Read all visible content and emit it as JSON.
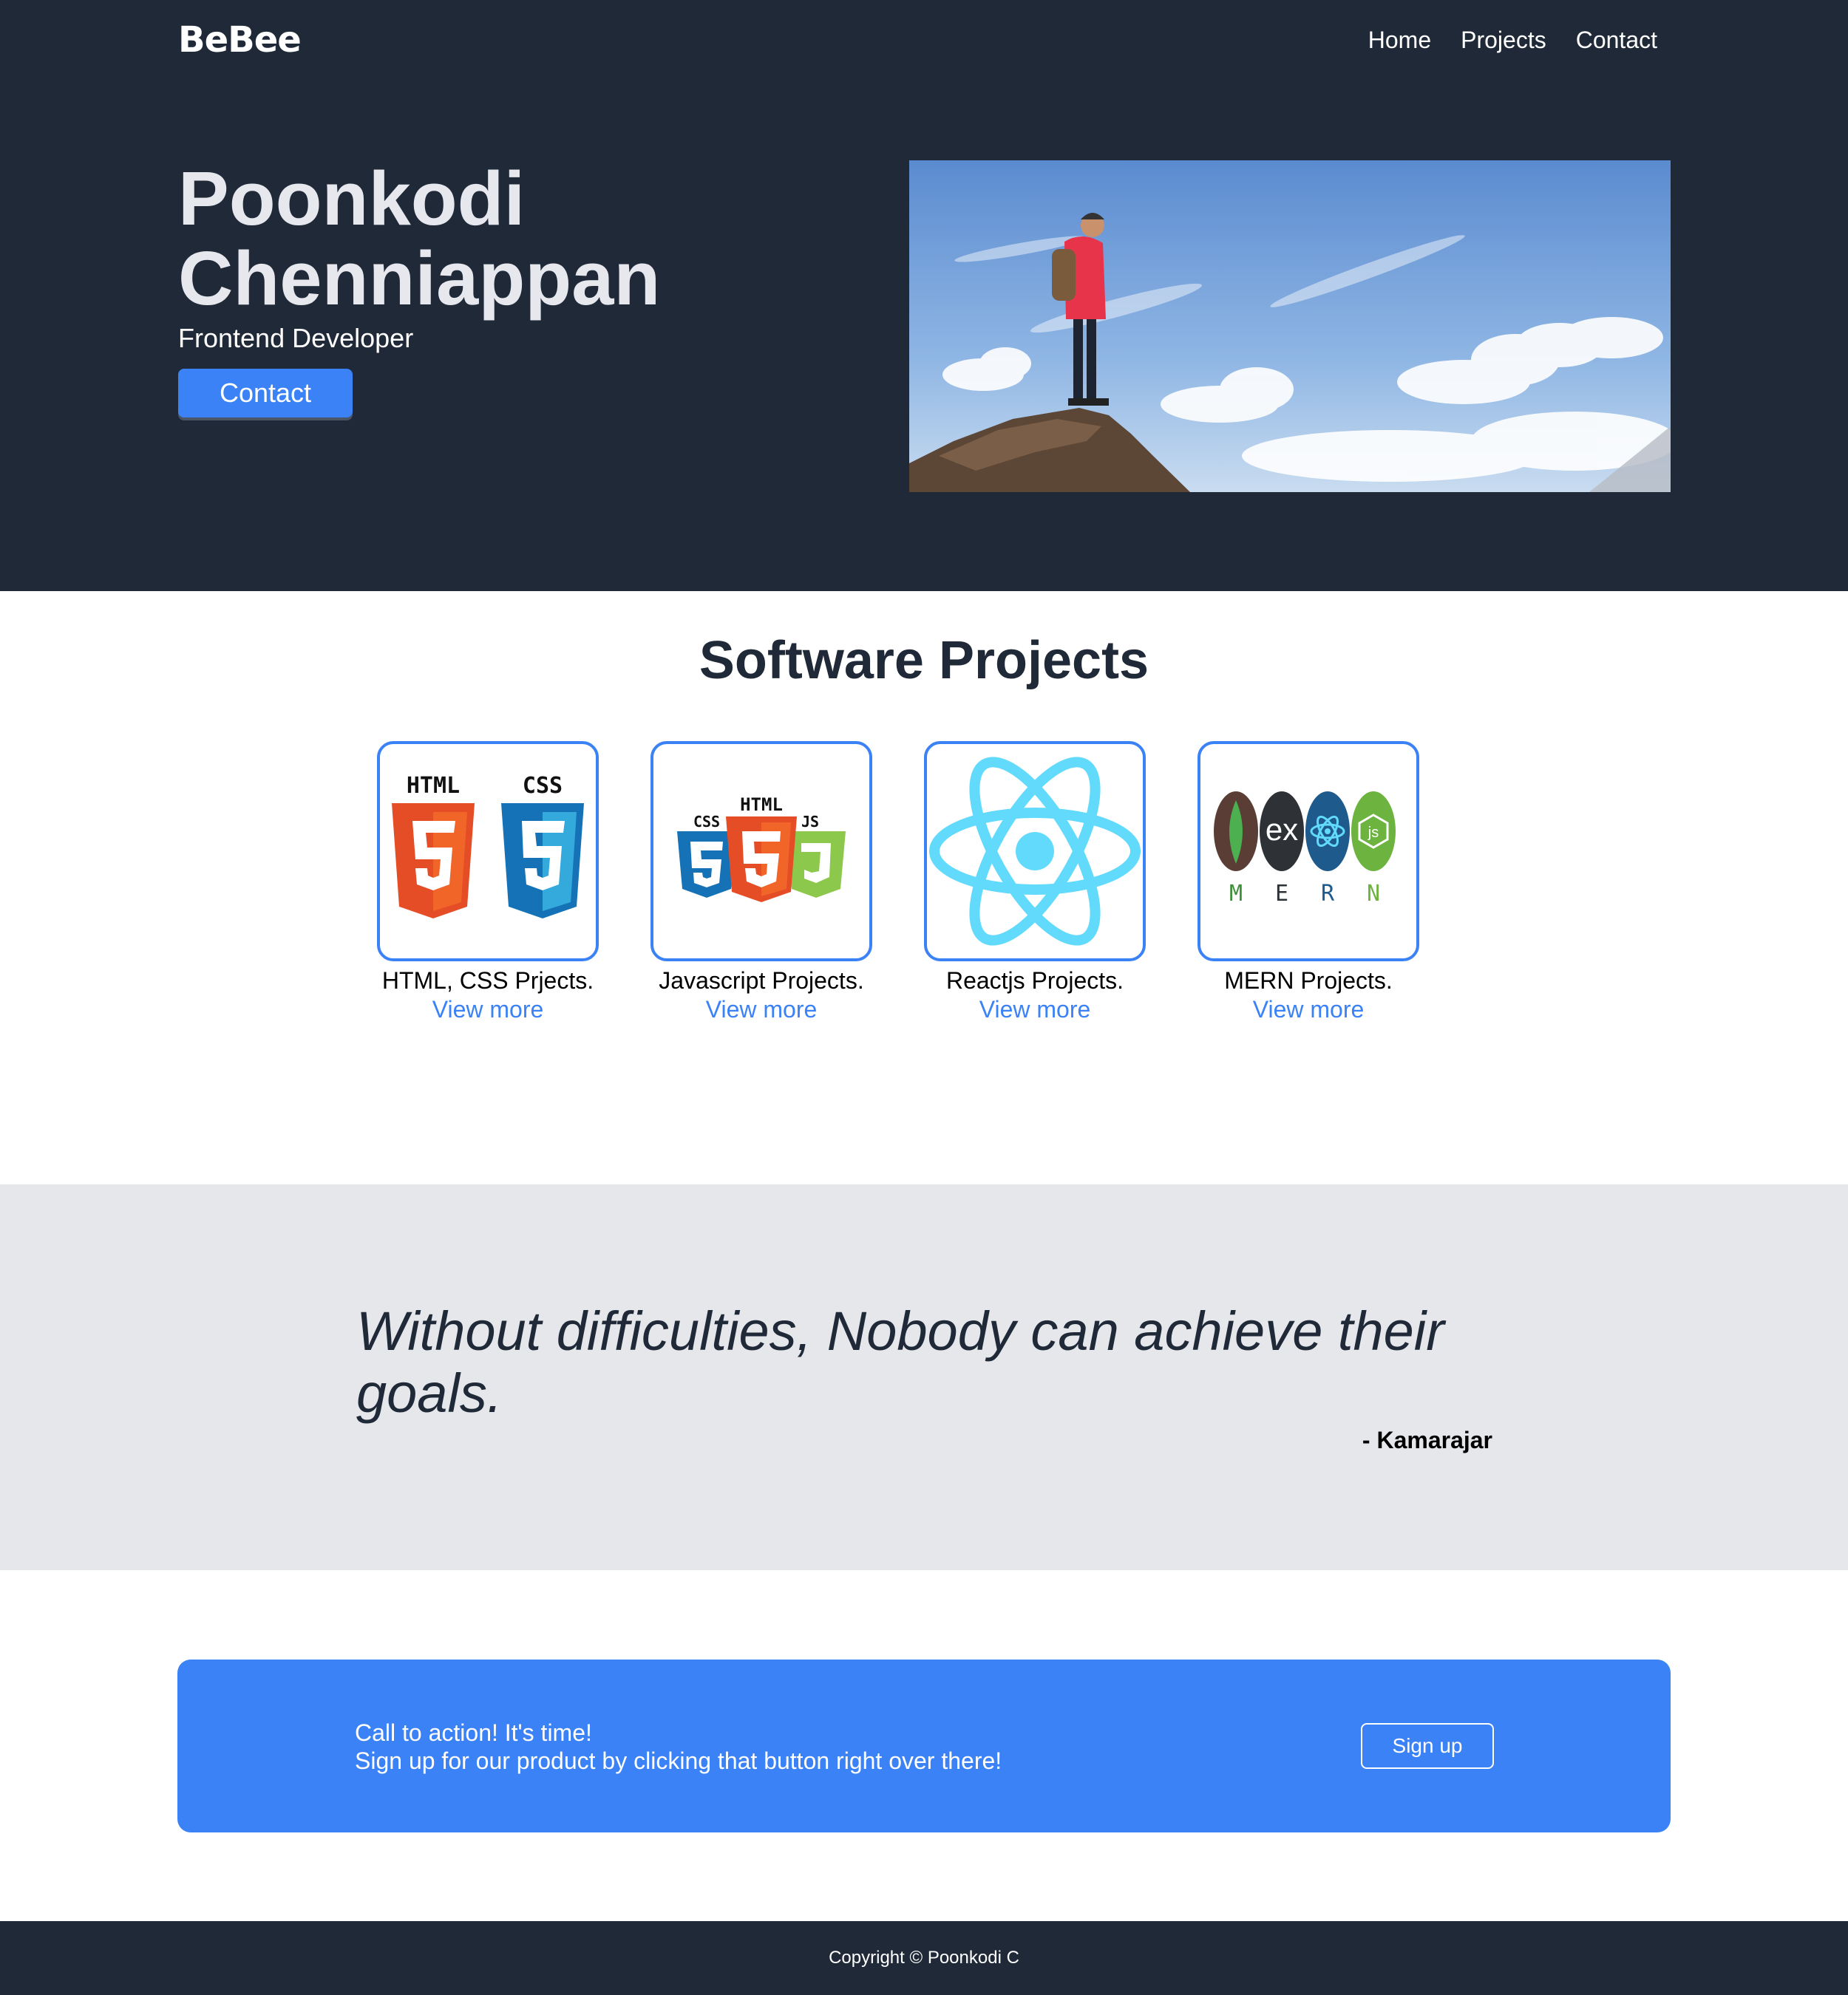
{
  "header": {
    "brand": "BeBee",
    "nav": [
      "Home",
      "Projects",
      "Contact"
    ]
  },
  "hero": {
    "name_line1": "Poonkodi",
    "name_line2": "Chenniappan",
    "role": "Frontend Developer",
    "contact_button": "Contact",
    "image": "hiker-on-cliff-photo"
  },
  "projects": {
    "title": "Software Projects",
    "cards": [
      {
        "title": "HTML, CSS Prjects.",
        "link": "View more",
        "icon": "html-css-logo-icon",
        "logo_labels": [
          "HTML",
          "CSS"
        ]
      },
      {
        "title": "Javascript Projects.",
        "link": "View more",
        "icon": "html-css-js-logo-icon",
        "logo_labels": [
          "CSS",
          "HTML",
          "JS"
        ]
      },
      {
        "title": "Reactjs Projects.",
        "link": "View more",
        "icon": "react-logo-icon"
      },
      {
        "title": "MERN Projects.",
        "link": "View more",
        "icon": "mern-logo-icon",
        "logo_labels": [
          "ex",
          "M",
          "E",
          "R",
          "N"
        ]
      }
    ]
  },
  "quote": {
    "text": "Without difficulties, Nobody can achieve their goals.",
    "author": "- Kamarajar"
  },
  "cta": {
    "line1": "Call to action! It's time!",
    "line2": "Sign up for our product by clicking that button right over there!",
    "button": "Sign up"
  },
  "footer": {
    "copyright": "Copyright © Poonkodi C"
  },
  "colors": {
    "dark": "#202938",
    "accent": "#3b82f6",
    "quote_bg": "#e5e7eb"
  }
}
